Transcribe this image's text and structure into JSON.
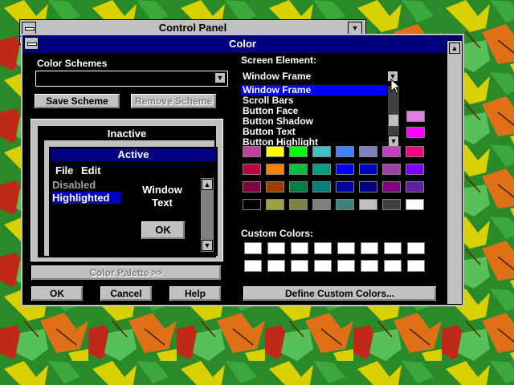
{
  "control_panel": {
    "title": "Control Panel"
  },
  "dialog": {
    "title": "Color",
    "color_schemes_label": "Color Schemes",
    "save_scheme": "Save Scheme",
    "remove_scheme": "Remove Scheme",
    "color_palette": "Color Palette >>",
    "ok": "OK",
    "cancel": "Cancel",
    "help": "Help",
    "screen_element_label": "Screen Element:",
    "screen_element_value": "Window Frame",
    "screen_elements": [
      "Window Frame",
      "Scroll Bars",
      "Button Face",
      "Button Shadow",
      "Button Text",
      "Button Highlight"
    ],
    "custom_colors_label": "Custom Colors:",
    "define_custom_colors": "Define Custom Colors..."
  },
  "preview": {
    "inactive": "Inactive",
    "active": "Active",
    "menu_file": "File",
    "menu_edit": "Edit",
    "disabled": "Disabled",
    "highlighted": "Highlighted",
    "window_text_1": "Window",
    "window_text_2": "Text",
    "ok": "OK"
  },
  "colors": {
    "basic": [
      [
        "#c040a0",
        "#ffff00",
        "#00ff00",
        "#40c0c0",
        "#4080ff",
        "#8080c0",
        "#c040c0",
        "#ff0080"
      ],
      [
        "#c00040",
        "#ff8000",
        "#00c040",
        "#00a080",
        "#0000ff",
        "#0000c0",
        "#a040a0",
        "#8000ff"
      ],
      [
        "#800040",
        "#a04000",
        "#008040",
        "#008080",
        "#0000a0",
        "#000080",
        "#800080",
        "#6020a0"
      ],
      [
        "#000000",
        "#a0a040",
        "#808040",
        "#808080",
        "#408080",
        "#c0c0c0",
        "#404040",
        "#ffffff"
      ]
    ],
    "side": [
      "#e080e0",
      "#ff00ff"
    ]
  }
}
